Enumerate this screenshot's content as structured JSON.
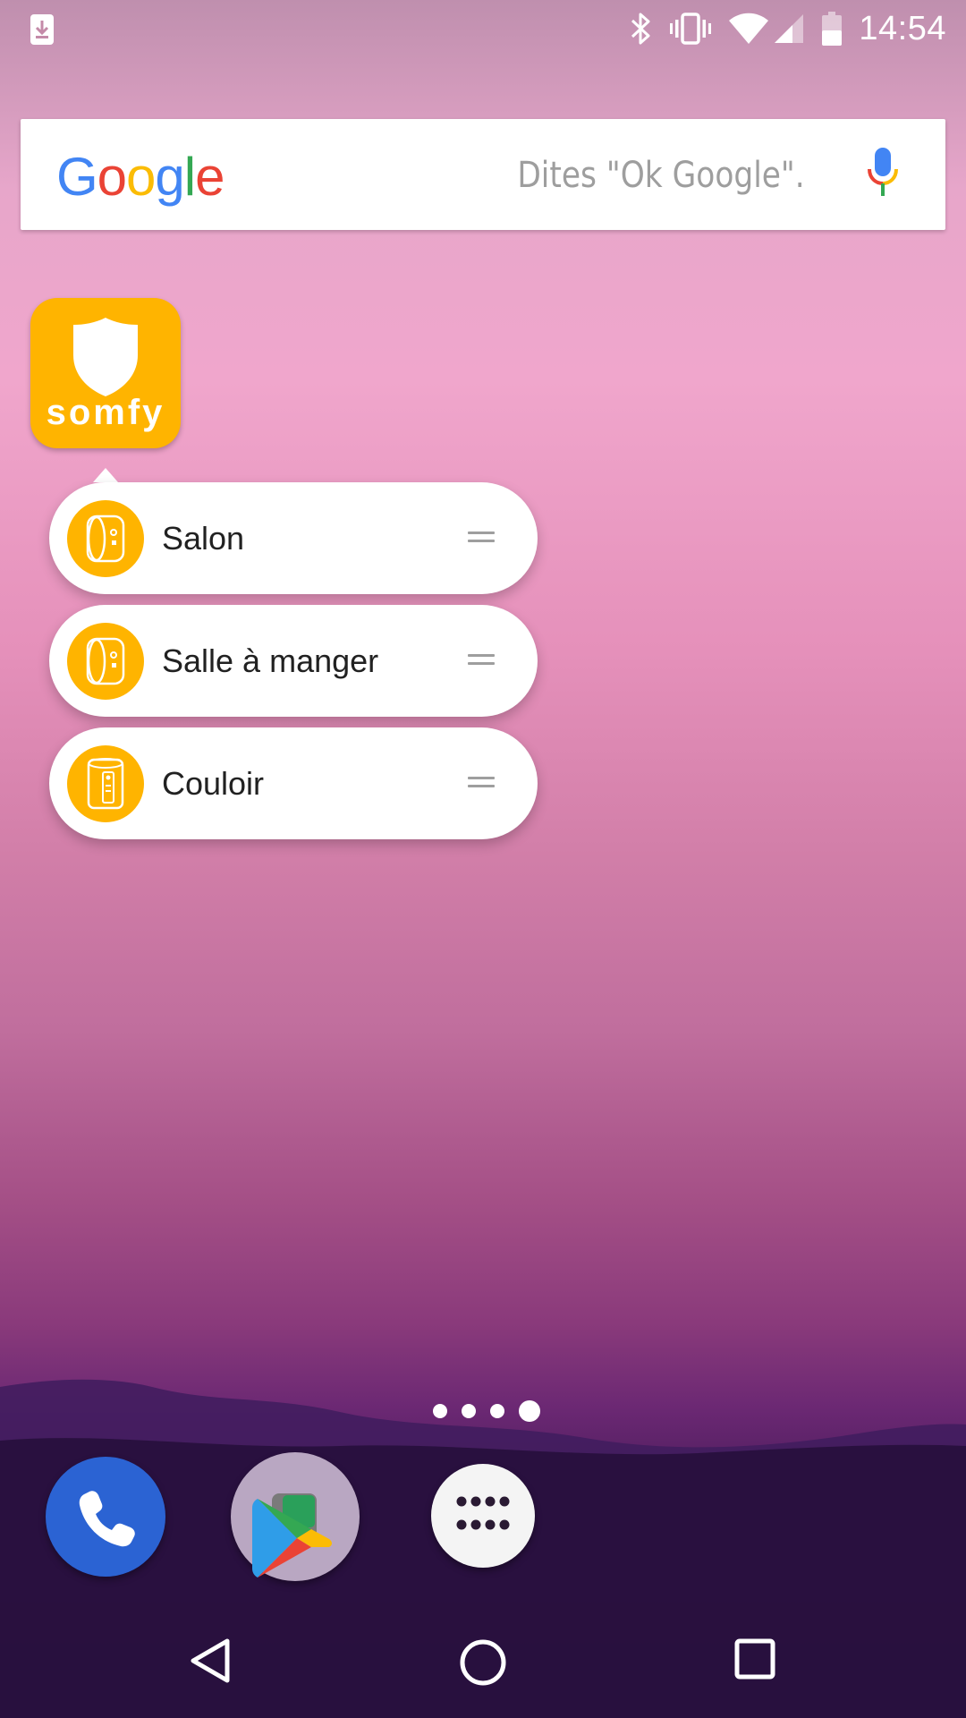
{
  "status_bar": {
    "time": "14:54",
    "icons": [
      "download-icon",
      "bluetooth-icon",
      "vibrate-icon",
      "wifi-icon",
      "signal-icon",
      "battery-icon"
    ]
  },
  "search": {
    "logo_letters": [
      {
        "char": "G",
        "color": "#4285F4"
      },
      {
        "char": "o",
        "color": "#EA4335"
      },
      {
        "char": "o",
        "color": "#FBBC05"
      },
      {
        "char": "g",
        "color": "#4285F4"
      },
      {
        "char": "l",
        "color": "#34A853"
      },
      {
        "char": "e",
        "color": "#EA4335"
      }
    ],
    "hint": "Dites \"Ok Google\".",
    "mic_icon": "mic-icon"
  },
  "app": {
    "brand": "somfy",
    "icon": "shield-icon",
    "color": "#FFB400"
  },
  "shortcuts": [
    {
      "label": "Salon",
      "icon": "camera-icon"
    },
    {
      "label": "Salle à manger",
      "icon": "camera-icon"
    },
    {
      "label": "Couloir",
      "icon": "sensor-icon"
    }
  ],
  "page_indicator": {
    "count": 4,
    "active": 4
  },
  "dock": [
    {
      "name": "phone",
      "icon": "phone-icon",
      "color": "#2B63D3"
    },
    {
      "name": "folder",
      "icon": "play-store-icon"
    },
    {
      "name": "app-drawer",
      "icon": "apps-grid-icon"
    }
  ],
  "nav": [
    "back-icon",
    "home-icon",
    "recents-icon"
  ]
}
